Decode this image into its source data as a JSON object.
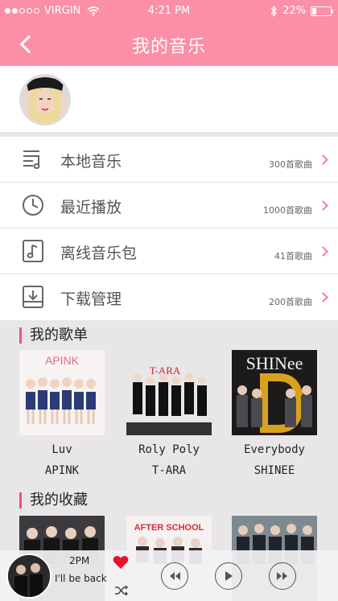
{
  "status_bar": {
    "carrier": "VIRGIN",
    "time": "4:21 PM",
    "battery": "22%",
    "signal_bars": 2
  },
  "header": {
    "title": "我的音乐",
    "back_icon": "chevron-left-icon",
    "background_color": "#fb8fa6"
  },
  "menu": [
    {
      "label": "本地音乐",
      "count": "300首歌曲",
      "icon": "playlist-icon"
    },
    {
      "label": "最近播放",
      "count": "1000首歌曲",
      "icon": "clock-icon"
    },
    {
      "label": "离线音乐包",
      "count": "41首歌曲",
      "icon": "music-note-icon"
    },
    {
      "label": "下载管理",
      "count": "200首歌曲",
      "icon": "download-icon"
    }
  ],
  "playlists": {
    "title": "我的歌单",
    "items": [
      {
        "title": "Luv",
        "artist": "APINK"
      },
      {
        "title": "Roly Poly",
        "artist": "T-ARA"
      },
      {
        "title": "Everybody",
        "artist": "SHINEE"
      }
    ]
  },
  "favorites": {
    "title": "我的收藏",
    "items": [
      {
        "cover_text": ""
      },
      {
        "cover_text": "AFTER SCHOOL"
      },
      {
        "cover_text": ""
      }
    ]
  },
  "player": {
    "artist": "2PM",
    "song": "I'll be back",
    "favorited": true
  },
  "colors": {
    "accent": "#ee4f7e",
    "chevron": "#f27c99",
    "heart": "#e8112d"
  }
}
